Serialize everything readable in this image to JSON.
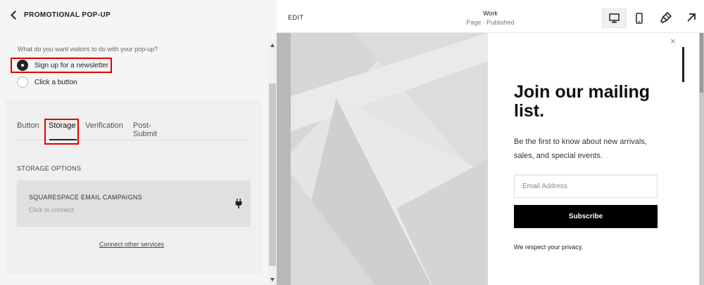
{
  "left_panel": {
    "title": "PROMOTIONAL POP-UP",
    "question": "What do you want visitors to do with your pop-up?",
    "options": [
      {
        "label": "Sign up for a newsletter",
        "selected": true
      },
      {
        "label": "Click a button",
        "selected": false
      }
    ],
    "tabs": [
      {
        "label": "Button",
        "active": false
      },
      {
        "label": "Storage",
        "active": true
      },
      {
        "label": "Verification",
        "active": false
      },
      {
        "label": "Post-Submit",
        "active": false
      }
    ],
    "storage_heading": "STORAGE OPTIONS",
    "campaign": {
      "title": "SQUARESPACE EMAIL CAMPAIGNS",
      "subtitle": "Click to connect",
      "icon": "plug-icon"
    },
    "connect_link": "Connect other services",
    "highlight_color": "#e00000"
  },
  "topbar": {
    "edit_label": "EDIT",
    "page_title": "Work",
    "page_status": "Page · Published",
    "devices": [
      {
        "icon": "desktop-icon",
        "active": true
      },
      {
        "icon": "mobile-icon",
        "active": false
      }
    ],
    "style_icon": "paintbrush-icon",
    "expand_icon": "arrow-up-right-icon"
  },
  "popup": {
    "close_glyph": "×",
    "heading": "Join our mailing list.",
    "description": "Be the first to know about new arrivals, sales, and special events.",
    "email_placeholder": "Email Address",
    "subscribe_label": "Subscribe",
    "privacy_note": "We respect your privacy."
  }
}
